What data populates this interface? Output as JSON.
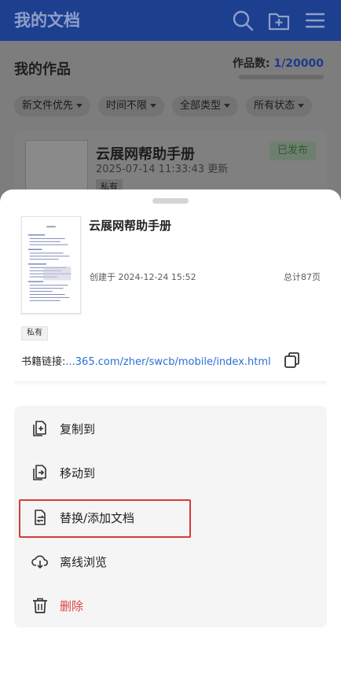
{
  "header": {
    "title": "我的文档",
    "icons": [
      "search-icon",
      "new-folder-icon",
      "menu-icon"
    ]
  },
  "works": {
    "title": "我的作品",
    "count_label": "作品数: ",
    "count_value": "1/20000"
  },
  "filters": [
    {
      "label": "新文件优先"
    },
    {
      "label": "时间不限"
    },
    {
      "label": "全部类型"
    },
    {
      "label": "所有状态"
    }
  ],
  "background_card": {
    "title": "云展网帮助手册",
    "time": "2025-07-14 11:33:43 更新",
    "status": "已发布",
    "privacy": "私有"
  },
  "sheet": {
    "doc_title": "云展网帮助手册",
    "created": "创建于 2024-12-24 15:52",
    "pages": "总计87页",
    "privacy": "私有",
    "link_label": "书籍链接:",
    "link_url": "...365.com/zher/swcb/mobile/index.html",
    "actions": [
      {
        "label": "复制到",
        "icon": "copy-to-icon"
      },
      {
        "label": "移动到",
        "icon": "move-to-icon"
      },
      {
        "label": "替换/添加文档",
        "icon": "replace-document-icon"
      },
      {
        "label": "离线浏览",
        "icon": "offline-download-icon"
      },
      {
        "label": "删除",
        "icon": "trash-icon"
      }
    ]
  },
  "colors": {
    "brand": "#1c3f8f",
    "link": "#2a6fd6",
    "danger": "#e04040",
    "highlight": "#d63a3a"
  }
}
